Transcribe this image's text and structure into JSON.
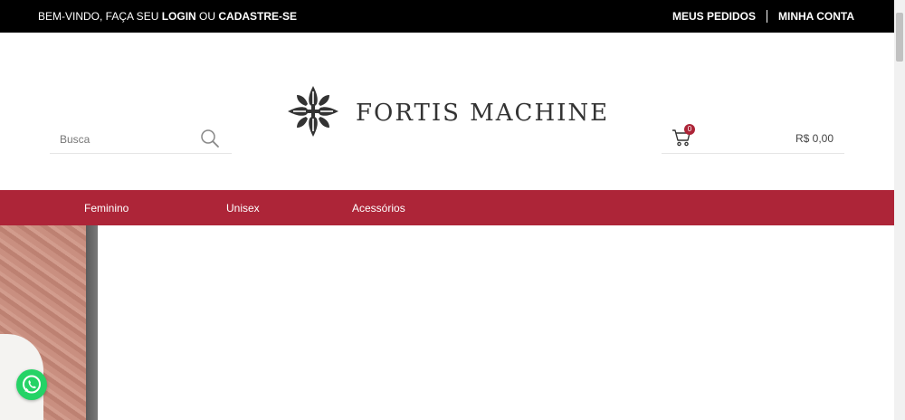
{
  "topbar": {
    "welcome_prefix": "BEM-VINDO, FAÇA SEU ",
    "login_label": "LOGIN",
    "welcome_or": " OU ",
    "register_label": "CADASTRE-SE",
    "orders_label": "MEUS PEDIDOS",
    "account_label": "MINHA CONTA"
  },
  "header": {
    "brand": "FORTIS MACHINE",
    "search": {
      "placeholder": "Busca",
      "value": ""
    },
    "cart": {
      "count": "0",
      "total": "R$ 0,00"
    }
  },
  "nav": {
    "items": [
      {
        "label": "Feminino"
      },
      {
        "label": "Unisex"
      },
      {
        "label": "Acessórios"
      }
    ]
  },
  "colors": {
    "topbar": "#000000",
    "nav": "#ad2538",
    "badge": "#ad2538",
    "whatsapp": "#25d366"
  },
  "icons": {
    "search": "search-icon",
    "cart": "cart-icon",
    "whatsapp": "whatsapp-icon",
    "logo": "cross-emblem-icon"
  }
}
